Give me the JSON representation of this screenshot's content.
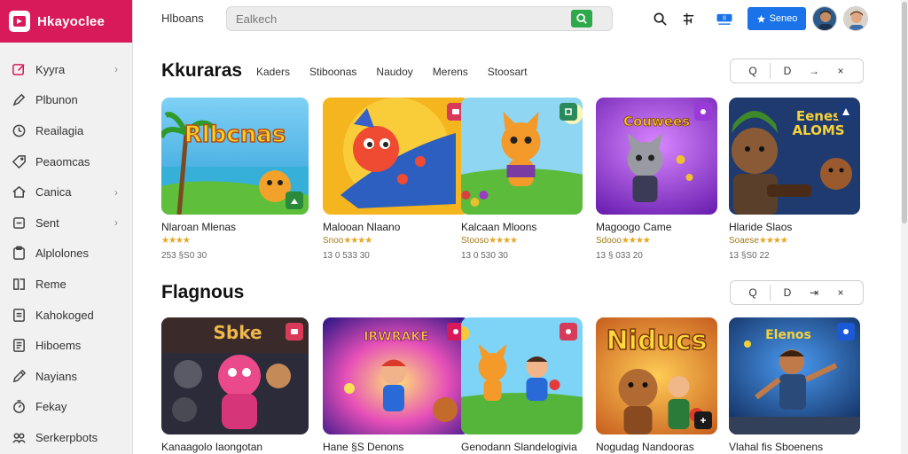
{
  "app": {
    "name": "Hkayoclee"
  },
  "sidebar": {
    "items": [
      {
        "label": "Kyyra",
        "icon": "edit-square-icon",
        "chevron": true
      },
      {
        "label": "Plbunon",
        "icon": "pen-icon",
        "chevron": false
      },
      {
        "label": "Reailagia",
        "icon": "clock-icon",
        "chevron": false
      },
      {
        "label": "Peaomcas",
        "icon": "tag-icon",
        "chevron": false
      },
      {
        "label": "Canica",
        "icon": "home-icon",
        "chevron": true
      },
      {
        "label": "Sent",
        "icon": "box-icon",
        "chevron": true
      },
      {
        "label": "Alplolones",
        "icon": "clipboard-icon",
        "chevron": false
      },
      {
        "label": "Reme",
        "icon": "book-icon",
        "chevron": false
      },
      {
        "label": "Kahokoged",
        "icon": "document-icon",
        "chevron": false
      },
      {
        "label": "Hiboems",
        "icon": "list-icon",
        "chevron": false
      },
      {
        "label": "Nayians",
        "icon": "pencil-icon",
        "chevron": false
      },
      {
        "label": "Fekay",
        "icon": "timer-icon",
        "chevron": false
      },
      {
        "label": "Serkerpbots",
        "icon": "people-icon",
        "chevron": false
      }
    ]
  },
  "header": {
    "link": "Hlboans",
    "search_placeholder": "Ealkech",
    "primary_button": "Seneo",
    "icons": [
      "search-icon",
      "filter-icon",
      "cart-icon"
    ]
  },
  "sections": [
    {
      "title": "Kkuraras",
      "tabs": [
        "Kaders",
        "Stiboonas",
        "Naudoy",
        "Merens",
        "Stoosart"
      ],
      "controls": [
        "Q",
        "D",
        "→",
        "×"
      ],
      "cards": [
        {
          "title": "Nlaroan Mlenas",
          "rating": "",
          "meta": "253 §S0 30",
          "art": "beach"
        },
        {
          "title": "Malooan Nlaano",
          "rating": "Snoo",
          "meta": "13 0 533 30",
          "art": "redfox"
        },
        {
          "title": "Kalcaan Mloons",
          "rating": "Stooso",
          "meta": "13 0 530 30",
          "art": "orangecat"
        },
        {
          "title": "Magoogo Came",
          "rating": "Sdooo",
          "meta": "13 § 033 20",
          "art": "purple"
        },
        {
          "title": "Hlaride Slaos",
          "rating": "Soaese",
          "meta": "13 §S0 22",
          "art": "bears"
        }
      ]
    },
    {
      "title": "Flagnous",
      "tabs": [],
      "controls": [
        "Q",
        "D",
        "⇥",
        "×"
      ],
      "cards": [
        {
          "title": "Kanaagolo Iaongotan",
          "art": "dark"
        },
        {
          "title": "Hane §S Denons",
          "art": "burst"
        },
        {
          "title": "Genodann Slandelogivia",
          "art": "field"
        },
        {
          "title": "Nogudag Nandooras",
          "art": "niducs"
        },
        {
          "title": "Vlahal fis Sboenens",
          "art": "hero"
        }
      ]
    }
  ],
  "colors": {
    "brand": "#d8195a",
    "accent": "#1a73e8",
    "search_button": "#2ea84a"
  }
}
